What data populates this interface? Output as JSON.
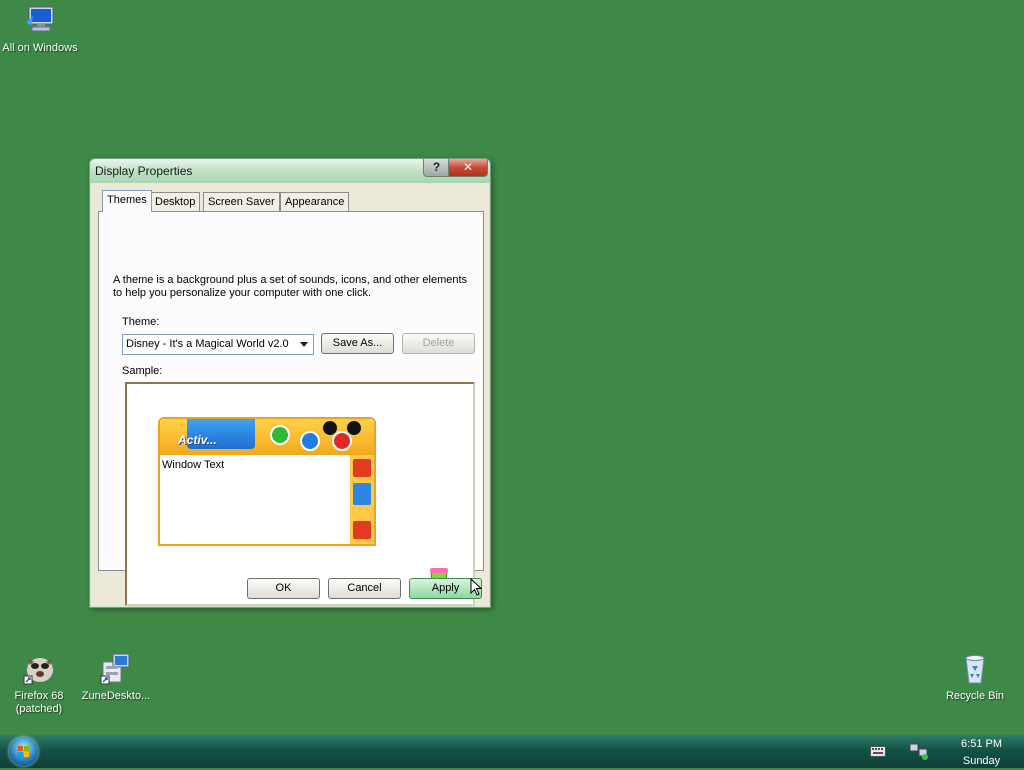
{
  "desktop": {
    "icons": [
      {
        "label": "All on Windows",
        "icon": "computer-icon"
      },
      {
        "label": "Firefox 68 (patched)",
        "icon": "firefox-icon"
      },
      {
        "label": "ZuneDeskto...",
        "icon": "installer-icon"
      },
      {
        "label": "Recycle Bin",
        "icon": "recycle-bin-icon"
      }
    ]
  },
  "dialog": {
    "title": "Display Properties",
    "help_glyph": "?",
    "close_glyph": "✕",
    "tabs": [
      "Themes",
      "Desktop",
      "Screen Saver",
      "Appearance"
    ],
    "active_tab": "Themes",
    "description": "A theme is a background plus a set of sounds, icons, and other elements to help you personalize your computer with one click.",
    "theme_label": "Theme:",
    "theme_value": "Disney - It's a Magical World v2.0",
    "save_as_label": "Save As...",
    "delete_label": "Delete",
    "sample_label": "Sample:",
    "sample": {
      "active_title": "Activ...",
      "window_text": "Window Text"
    },
    "ok_label": "OK",
    "cancel_label": "Cancel",
    "apply_label": "Apply"
  },
  "taskbar": {
    "time": "6:51 PM",
    "day": "Sunday"
  },
  "colors": {
    "desktop_bg": "#3e8947",
    "dialog_bg": "#ece9d8",
    "accent_green": "#8fd8a0"
  }
}
